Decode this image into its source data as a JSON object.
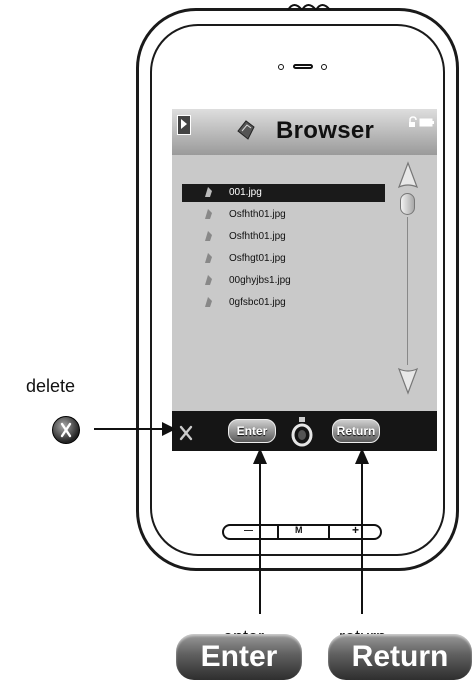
{
  "screen": {
    "title": "Browser",
    "files": [
      {
        "name": "001.jpg",
        "selected": true
      },
      {
        "name": "Osfhth01.jpg",
        "selected": false
      },
      {
        "name": "Osfhth01.jpg",
        "selected": false
      },
      {
        "name": "Osfhgt01.jpg",
        "selected": false
      },
      {
        "name": "00ghyjbs1.jpg",
        "selected": false
      },
      {
        "name": "0gfsbc01.jpg",
        "selected": false
      }
    ],
    "bottom_buttons": {
      "enter": "Enter",
      "return": "Return"
    }
  },
  "home_buttons": {
    "minus": "—",
    "menu": "M",
    "plus": "+"
  },
  "annotations": {
    "delete": "delete",
    "enter": "enter",
    "return": "return"
  },
  "callout_buttons": {
    "enter": "Enter",
    "return": "Return"
  },
  "icons": [
    "play-icon",
    "book-icon",
    "lock-battery-icon",
    "file-icon",
    "scroll-up-arrow-icon",
    "scroll-down-arrow-icon",
    "delete-x-icon",
    "ring-icon"
  ],
  "colors": {
    "screen_bg": "#c9c9c9",
    "bar_dark": "#151515",
    "selected_row": "#1a1a1a"
  }
}
